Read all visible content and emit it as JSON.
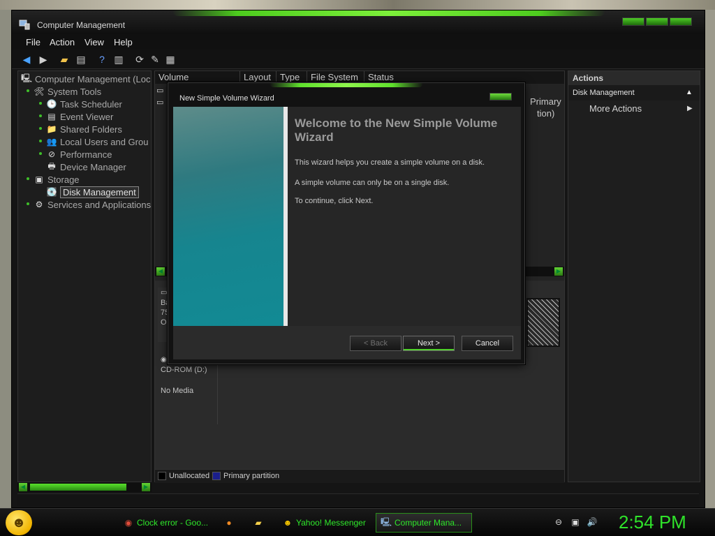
{
  "window": {
    "title": "Computer Management",
    "menu": [
      "File",
      "Action",
      "View",
      "Help"
    ]
  },
  "tree": {
    "root": "Computer Management (Loc",
    "system_tools": "System Tools",
    "task_scheduler": "Task Scheduler",
    "event_viewer": "Event Viewer",
    "shared_folders": "Shared Folders",
    "local_users": "Local Users and Grou",
    "performance": "Performance",
    "device_manager": "Device Manager",
    "storage": "Storage",
    "disk_management": "Disk Management",
    "services": "Services and Applications"
  },
  "volume_list": {
    "columns": [
      "Volume",
      "Layout",
      "Type",
      "File System",
      "Status"
    ],
    "fragment_primary": "Primary",
    "fragment_ition": "tion)"
  },
  "disk_graphic": {
    "disk0_lines": [
      "Ba",
      "75",
      "O"
    ],
    "cdrom_label": "CD-ROM (D:)",
    "cdrom_media": "No Media",
    "legend_unallocated": "Unallocated",
    "legend_primary": "Primary partition"
  },
  "actions": {
    "header": "Actions",
    "section": "Disk Management",
    "more": "More Actions"
  },
  "wizard": {
    "title": "New Simple Volume Wizard",
    "heading": "Welcome to the New Simple Volume Wizard",
    "p1": "This wizard helps you create a simple volume on a disk.",
    "p2": "A simple volume can only be on a single disk.",
    "p3": "To continue, click Next.",
    "back": "< Back",
    "next": "Next >",
    "cancel": "Cancel"
  },
  "taskbar": {
    "tasks": [
      "Clock error - Goo...",
      "Yahoo! Messenger",
      "Computer Mana..."
    ],
    "clock": "2:54 PM"
  },
  "colors": {
    "accent_green": "#4dcc1e",
    "wizard_banner": "#16858f",
    "legend_unallocated": "#000000",
    "legend_primary": "#1b1f8c"
  }
}
